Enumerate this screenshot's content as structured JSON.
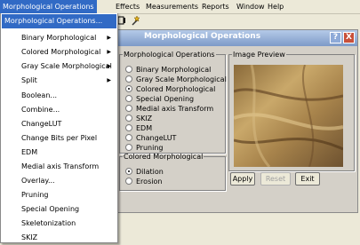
{
  "menubar": {
    "items": [
      "Morphological Operations",
      "Effects",
      "Measurements",
      "Reports",
      "Window",
      "Help"
    ]
  },
  "dropdown": {
    "items": [
      {
        "label": "Morphological Operations...",
        "submenu": false,
        "highlighted": true
      },
      {
        "label": "Binary Morphological",
        "submenu": true
      },
      {
        "label": "Colored Morphological",
        "submenu": true
      },
      {
        "label": "Gray Scale Morphological",
        "submenu": true
      },
      {
        "label": "Split",
        "submenu": true
      },
      {
        "label": "Boolean...",
        "submenu": false
      },
      {
        "label": "Combine...",
        "submenu": false
      },
      {
        "label": "ChangeLUT",
        "submenu": false
      },
      {
        "label": "Change Bits per Pixel",
        "submenu": false
      },
      {
        "label": "EDM",
        "submenu": false
      },
      {
        "label": "Medial axis Transform",
        "submenu": false
      },
      {
        "label": "Overlay...",
        "submenu": false
      },
      {
        "label": "Pruning",
        "submenu": false
      },
      {
        "label": "Special Opening",
        "submenu": false
      },
      {
        "label": "Skeletonization",
        "submenu": false
      },
      {
        "label": "SKIZ",
        "submenu": false
      }
    ],
    "submenu_arrow": "▶"
  },
  "dialog": {
    "title": "Morphological Operations",
    "help_label": "?",
    "close_label": "X",
    "ops_group": {
      "legend": "Morphological Operations",
      "options": [
        {
          "label": "Binary Morphological",
          "checked": false
        },
        {
          "label": "Gray Scale Morphological",
          "checked": false
        },
        {
          "label": "Colored Morphological",
          "checked": true
        },
        {
          "label": "Special Opening",
          "checked": false
        },
        {
          "label": "Medial axis Transform",
          "checked": false
        },
        {
          "label": "SKIZ",
          "checked": false
        },
        {
          "label": "EDM",
          "checked": false
        },
        {
          "label": "ChangeLUT",
          "checked": false
        },
        {
          "label": "Pruning",
          "checked": false
        }
      ]
    },
    "colored_group": {
      "legend": "Colored Morphological",
      "options": [
        {
          "label": "Dilation",
          "checked": true
        },
        {
          "label": "Erosion",
          "checked": false
        }
      ]
    },
    "preview": {
      "legend": "Image Preview"
    },
    "buttons": {
      "apply": "Apply",
      "reset": "Reset",
      "exit": "Exit"
    }
  },
  "colors": {
    "highlight": "#316ac5",
    "titlebar": "#7d9ac8",
    "face": "#d4d0c8",
    "close": "#c8503a"
  }
}
